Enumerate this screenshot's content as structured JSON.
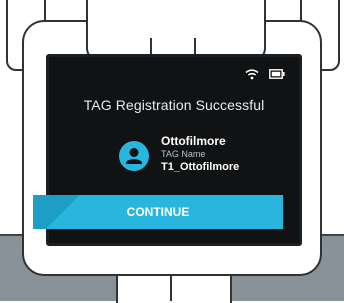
{
  "screen": {
    "title": "TAG Registration Successful",
    "status_icons": [
      "wifi-icon",
      "battery-icon"
    ]
  },
  "tag": {
    "user_name": "Ottofilmore",
    "tag_label": "TAG Name",
    "tag_value": "T1_Ottofilmore",
    "avatar_icon": "user-icon"
  },
  "actions": {
    "continue_label": "CONTINUE"
  },
  "colors": {
    "accent": "#29b6de",
    "screen_bg": "#101213",
    "bench": "#8a9299"
  }
}
